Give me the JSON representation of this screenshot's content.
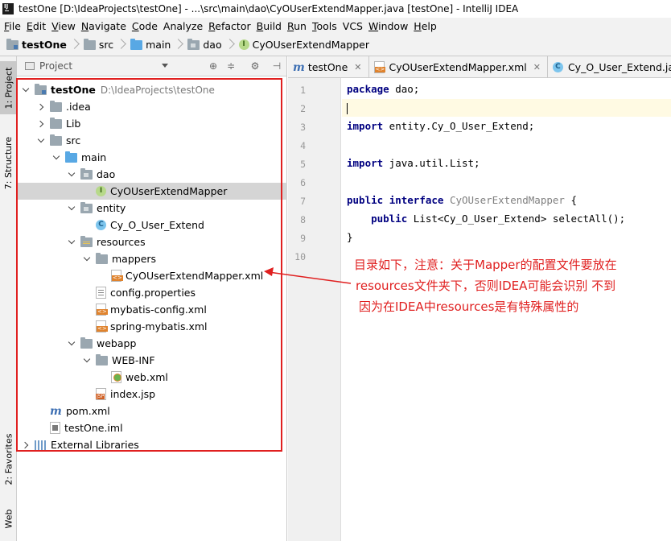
{
  "window": {
    "title": "testOne [D:\\IdeaProjects\\testOne] - ...\\src\\main\\dao\\CyOUserExtendMapper.java [testOne] - IntelliJ IDEA"
  },
  "menu": [
    {
      "label": "File",
      "mnemonic": "F",
      "rest": "ile"
    },
    {
      "label": "Edit",
      "mnemonic": "E",
      "rest": "dit"
    },
    {
      "label": "View",
      "mnemonic": "V",
      "rest": "iew"
    },
    {
      "label": "Navigate",
      "mnemonic": "N",
      "rest": "avigate"
    },
    {
      "label": "Code",
      "mnemonic": "C",
      "rest": "ode"
    },
    {
      "label": "Analyze",
      "mnemonic": "",
      "rest": "Analyze"
    },
    {
      "label": "Refactor",
      "mnemonic": "R",
      "rest": "efactor"
    },
    {
      "label": "Build",
      "mnemonic": "B",
      "rest": "uild"
    },
    {
      "label": "Run",
      "mnemonic": "R",
      "rest": "un"
    },
    {
      "label": "Tools",
      "mnemonic": "T",
      "rest": "ools"
    },
    {
      "label": "VCS",
      "mnemonic": "",
      "rest": "VCS"
    },
    {
      "label": "Window",
      "mnemonic": "W",
      "rest": "indow"
    },
    {
      "label": "Help",
      "mnemonic": "H",
      "rest": "elp"
    }
  ],
  "breadcrumb": [
    "testOne",
    "src",
    "main",
    "dao",
    "CyOUserExtendMapper"
  ],
  "left_strip": {
    "project_tab": "1: Project",
    "structure_tab": "7: Structure",
    "favorites_tab": "2: Favorites",
    "web_tab": "Web"
  },
  "project_panel": {
    "header_label": "Project",
    "tree": [
      {
        "label": "testOne",
        "path": "D:\\IdeaProjects\\testOne",
        "icon": "project-folder-icon",
        "expanded": true
      },
      {
        "label": ".idea",
        "icon": "folder-icon",
        "expanded": false
      },
      {
        "label": "Lib",
        "icon": "folder-icon",
        "expanded": false
      },
      {
        "label": "src",
        "icon": "folder-icon",
        "expanded": true
      },
      {
        "label": "main",
        "icon": "source-folder-icon",
        "expanded": true
      },
      {
        "label": "dao",
        "icon": "package-icon",
        "expanded": true
      },
      {
        "label": "CyOUserExtendMapper",
        "icon": "interface-icon",
        "selected": true
      },
      {
        "label": "entity",
        "icon": "package-icon",
        "expanded": true
      },
      {
        "label": "Cy_O_User_Extend",
        "icon": "class-icon"
      },
      {
        "label": "resources",
        "icon": "resources-folder-icon",
        "expanded": true
      },
      {
        "label": "mappers",
        "icon": "folder-icon",
        "expanded": true
      },
      {
        "label": "CyOUserExtendMapper.xml",
        "icon": "xml-file-icon"
      },
      {
        "label": "config.properties",
        "icon": "properties-file-icon"
      },
      {
        "label": "mybatis-config.xml",
        "icon": "xml-file-icon"
      },
      {
        "label": "spring-mybatis.xml",
        "icon": "spring-xml-file-icon"
      },
      {
        "label": "webapp",
        "icon": "folder-icon",
        "expanded": true
      },
      {
        "label": "WEB-INF",
        "icon": "folder-icon",
        "expanded": true
      },
      {
        "label": "web.xml",
        "icon": "web-xml-file-icon"
      },
      {
        "label": "index.jsp",
        "icon": "jsp-file-icon"
      },
      {
        "label": "pom.xml",
        "icon": "maven-icon"
      },
      {
        "label": "testOne.iml",
        "icon": "iml-file-icon"
      },
      {
        "label": "External Libraries",
        "icon": "libraries-icon",
        "expanded": false
      }
    ]
  },
  "editor": {
    "tabs": [
      {
        "label": "testOne",
        "icon": "maven-icon",
        "active": false
      },
      {
        "label": "CyOUserExtendMapper.xml",
        "icon": "xml-file-icon",
        "active": false
      },
      {
        "label": "Cy_O_User_Extend.java",
        "icon": "class-icon",
        "active": false
      }
    ],
    "line_numbers": [
      "1",
      "2",
      "3",
      "4",
      "5",
      "6",
      "7",
      "8",
      "9",
      "10"
    ],
    "code": {
      "l1_kw": "package",
      "l1_rest": " dao;",
      "l3_kw": "import",
      "l3_rest": " entity.Cy_O_User_Extend;",
      "l5_kw": "import",
      "l5_rest": " java.util.List;",
      "l7_kw1": "public",
      "l7_kw2": "interface",
      "l7_name": "CyOUserExtendMapper",
      "l7_rest": " {",
      "l8_indent": "    ",
      "l8_kw": "public",
      "l8_rest": " List<Cy_O_User_Extend> selectAll();",
      "l9": "}"
    }
  },
  "annotation": {
    "line1": "目录如下，注意：关于Mapper的配置文件要放在",
    "line2": "resources文件夹下，否则IDEA可能会识别  不到",
    "line3": "因为在IDEA中resources是有特殊属性的",
    "color": "#e02020"
  }
}
